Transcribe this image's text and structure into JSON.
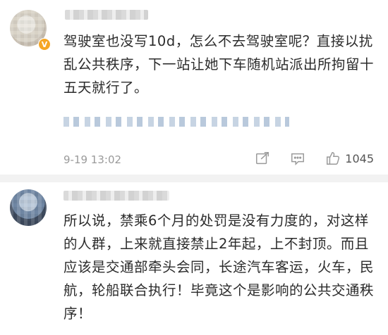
{
  "comments": [
    {
      "text": "驾驶室也没写10d，怎么不去驾驶室呢？直接以扰乱公共秩序，下一站让她下车随机站派出所拘留十五天就行了。",
      "timestamp": "9-19 13:02",
      "like_count": "1045",
      "badge": "V"
    },
    {
      "text": "所以说，禁乘6个月的处罚是没有力度的，对这样的人群，上来就直接禁止2年起，上不封顶。而且应该是交通部牵头会同，长途汽车客运，火车，民航，轮船联合执行！毕竟这个是影响的公共交通秩序！"
    }
  ],
  "icons": {
    "share": "share-icon",
    "comment": "comment-icon",
    "like": "thumbs-up-icon"
  },
  "colors": {
    "text": "#2b2b2b",
    "meta": "#9a9a9a",
    "badge": "#f6a623",
    "divider": "#f2f2f2"
  }
}
